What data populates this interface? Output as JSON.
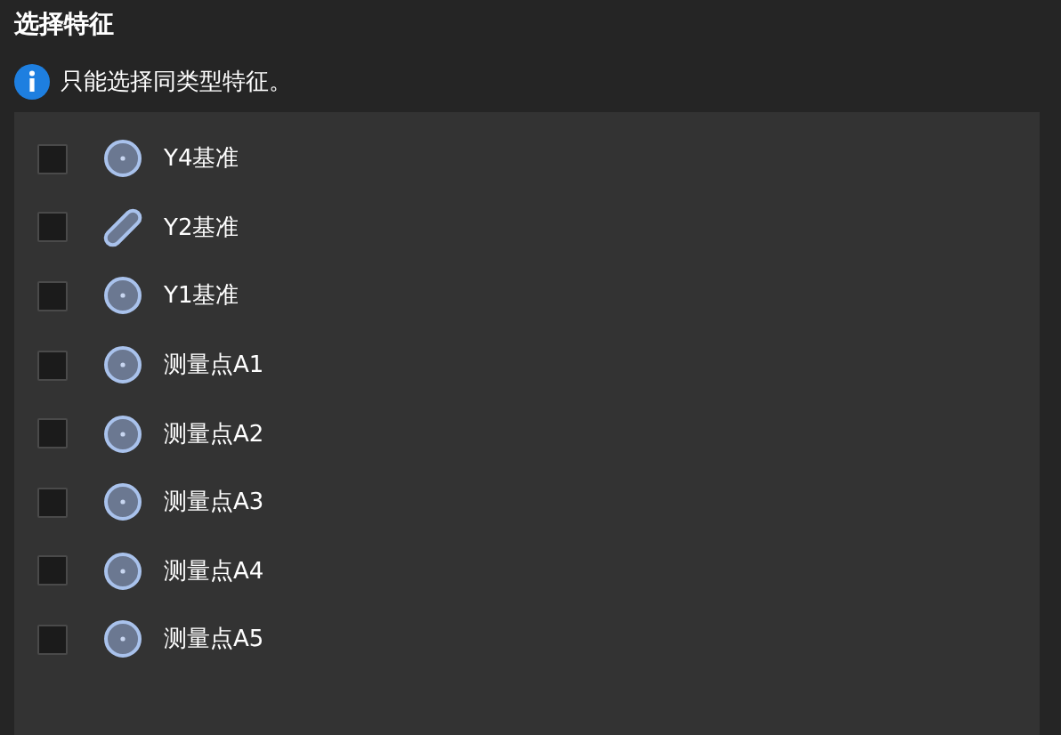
{
  "title": "选择特征",
  "notice": "只能选择同类型特征。",
  "features": [
    {
      "label": "Y4基准",
      "kind": "circle",
      "checked": false
    },
    {
      "label": "Y2基准",
      "kind": "slot",
      "checked": false
    },
    {
      "label": "Y1基准",
      "kind": "circle",
      "checked": false
    },
    {
      "label": "测量点A1",
      "kind": "circle",
      "checked": false
    },
    {
      "label": "测量点A2",
      "kind": "circle",
      "checked": false
    },
    {
      "label": "测量点A3",
      "kind": "circle",
      "checked": false
    },
    {
      "label": "测量点A4",
      "kind": "circle",
      "checked": false
    },
    {
      "label": "测量点A5",
      "kind": "circle",
      "checked": false
    }
  ]
}
